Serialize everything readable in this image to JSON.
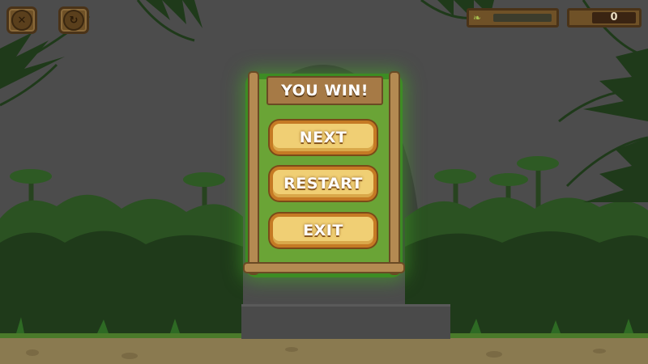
{
  "hud": {
    "close_icon": "close-icon",
    "restart_icon": "restart-icon",
    "progress": {
      "fraction": 0.0,
      "icon": "leaf-icon"
    },
    "score": "0"
  },
  "dialog": {
    "title": "YOU WIN!",
    "buttons": {
      "next": "NEXT",
      "restart": "RESTART",
      "exit": "EXIT"
    }
  },
  "colors": {
    "background": "#4c4c4c",
    "jungle_dark": "#1f3a1a",
    "jungle_mid": "#2e5a24",
    "panel_green": "#6aa436",
    "button_fill": "#f0cf74",
    "wood": "#b48a52"
  }
}
